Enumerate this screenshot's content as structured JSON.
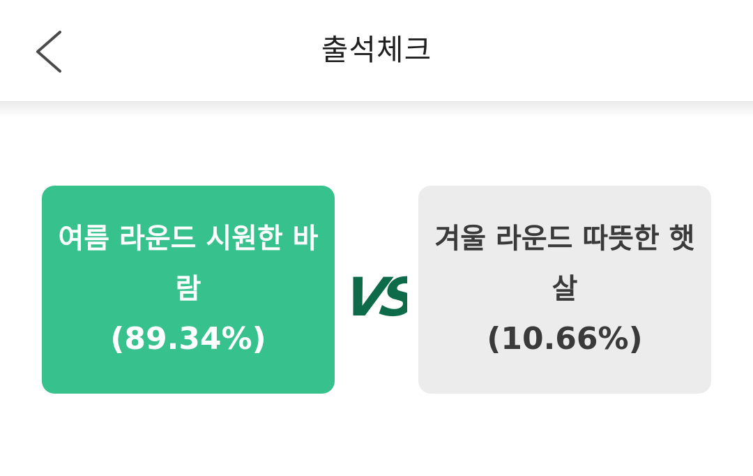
{
  "header": {
    "title": "출석체크",
    "back_icon": "chevron-left-icon"
  },
  "poll": {
    "left": {
      "label": "여름 라운드 시원한 바람",
      "percent_text": "(89.34%)",
      "percent": 89.34,
      "color": "#36c18d",
      "selected": true
    },
    "right": {
      "label": "겨울 라운드 따뜻한 햇살",
      "percent_text": "(10.66%)",
      "percent": 10.66,
      "color": "#ececec",
      "selected": false
    },
    "vs_label": "VS",
    "vs_color": "#0e6b4a"
  }
}
